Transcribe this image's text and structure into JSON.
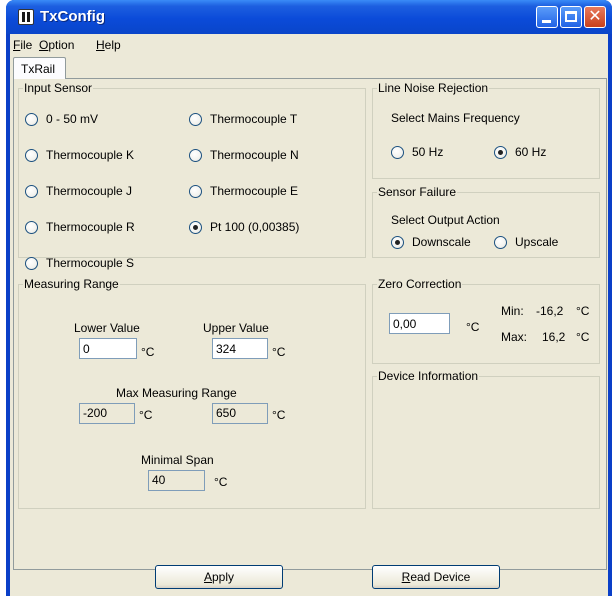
{
  "window": {
    "title": "TxConfig"
  },
  "menu": [
    {
      "mnemonic": "F",
      "rest": "ile"
    },
    {
      "mnemonic": "O",
      "rest": "ption"
    },
    {
      "mnemonic": "H",
      "rest": "elp"
    }
  ],
  "tabs": [
    {
      "label": "TxRail",
      "selected": true
    }
  ],
  "input_sensor": {
    "legend": "Input Sensor",
    "options": [
      {
        "label": "0 - 50 mV",
        "selected": false
      },
      {
        "label": "Thermocouple K",
        "selected": false
      },
      {
        "label": "Thermocouple J",
        "selected": false
      },
      {
        "label": "Thermocouple R",
        "selected": false
      },
      {
        "label": "Thermocouple S",
        "selected": false
      },
      {
        "label": "Thermocouple T",
        "selected": false
      },
      {
        "label": "Thermocouple N",
        "selected": false
      },
      {
        "label": "Thermocouple E",
        "selected": false
      },
      {
        "label": "Pt 100 (0,00385)",
        "selected": true
      }
    ]
  },
  "line_noise": {
    "legend": "Line Noise Rejection",
    "caption": "Select Mains Frequency",
    "options": [
      {
        "label": "50 Hz",
        "selected": false
      },
      {
        "label": "60 Hz",
        "selected": true
      }
    ]
  },
  "sensor_failure": {
    "legend": "Sensor Failure",
    "caption": "Select Output Action",
    "options": [
      {
        "label": "Downscale",
        "selected": true
      },
      {
        "label": "Upscale",
        "selected": false
      }
    ]
  },
  "measuring_range": {
    "legend": "Measuring Range",
    "lower_label": "Lower Value",
    "lower_value": "0",
    "upper_label": "Upper Value",
    "upper_value": "324",
    "max_label": "Max Measuring Range",
    "max_low": "-200",
    "max_high": "650",
    "span_label": "Minimal Span",
    "span_value": "40",
    "unit": "°C"
  },
  "zero_correction": {
    "legend": "Zero Correction",
    "value": "0,00",
    "unit": "°C",
    "min_label": "Min:",
    "min_value": "-16,2",
    "max_label": "Max:",
    "max_value": "16,2"
  },
  "device_info": {
    "legend": "Device Information"
  },
  "buttons": {
    "apply": {
      "mnemonic": "A",
      "rest": "pply"
    },
    "read_device": {
      "mnemonic": "R",
      "rest": "ead Device"
    }
  },
  "colors": {
    "titlebar": "#0b4bd9",
    "face": "#ece9d8",
    "radio_selected": "#21a121",
    "close_button": "#c8401c"
  }
}
